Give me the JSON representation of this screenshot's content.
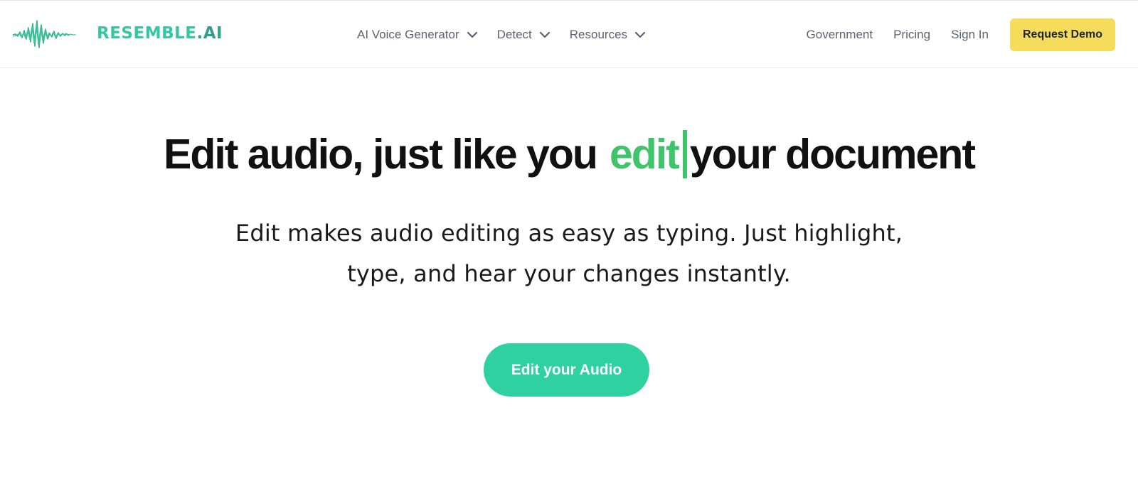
{
  "brand": {
    "name": "RESEMBLE",
    "suffix": ".AI",
    "logo_icon": "waveform-icon",
    "color": "#37c6a3"
  },
  "nav": {
    "dropdowns": [
      {
        "label": "AI Voice Generator",
        "icon": "chevron-down-icon"
      },
      {
        "label": "Detect",
        "icon": "chevron-down-icon"
      },
      {
        "label": "Resources",
        "icon": "chevron-down-icon"
      }
    ],
    "links": [
      {
        "label": "Government"
      },
      {
        "label": "Pricing"
      },
      {
        "label": "Sign In"
      }
    ],
    "cta": {
      "label": "Request Demo",
      "color": "#f5dd5b"
    }
  },
  "hero": {
    "headline_start": "Edit audio, just like you",
    "headline_accent": "edit",
    "headline_end": "your document",
    "accent_color": "#3fc36b",
    "subtext_line1": "Edit makes audio editing as easy as typing. Just highlight,",
    "subtext_line2": "type, and hear your changes instantly.",
    "cta_label": "Edit your Audio",
    "cta_color": "#30d1a0"
  }
}
